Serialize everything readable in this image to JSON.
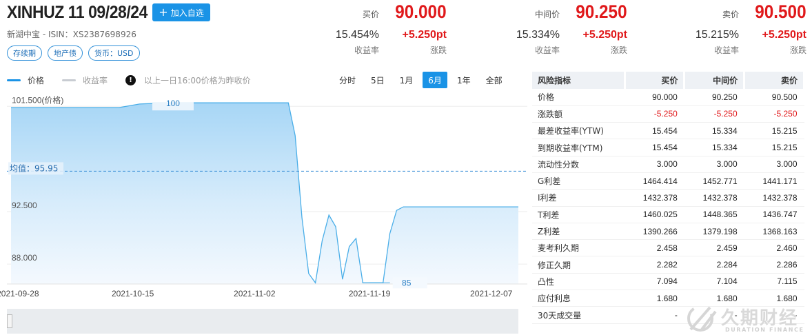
{
  "header": {
    "bond_name": "XINHUZ 11 09/28/24",
    "add_watchlist_label": "加入自选",
    "issuer": "新湖中宝",
    "isin_prefix": " - ISIN：",
    "isin": "XS2387698926",
    "tags": [
      "存续期",
      "地产债",
      "货币：USD"
    ]
  },
  "quotes": [
    {
      "label": "买价",
      "price": "90.000",
      "yield": "15.454%",
      "yield_label": "收益率",
      "change": "+5.250pt",
      "change_label": "涨跌"
    },
    {
      "label": "中间价",
      "price": "90.250",
      "yield": "15.334%",
      "yield_label": "收益率",
      "change": "+5.250pt",
      "change_label": "涨跌"
    },
    {
      "label": "卖价",
      "price": "90.500",
      "yield": "15.215%",
      "yield_label": "收益率",
      "change": "+5.250pt",
      "change_label": "涨跌"
    }
  ],
  "chart_toolbar": {
    "legend_price": "价格",
    "legend_yield": "收益率",
    "note": "以上一日16:00价格为昨收价",
    "ranges": [
      "分时",
      "5日",
      "1月",
      "6月",
      "1年",
      "全部"
    ],
    "active_range": "6月"
  },
  "colors": {
    "accent": "#1a93e6",
    "price_line": "#4aaee8",
    "up_red": "#e0191b",
    "yield_line": "#c8ccd2"
  },
  "chart_data": {
    "type": "area",
    "y_axis_labels": [
      "101.500(价格)",
      "92.500",
      "88.000"
    ],
    "y_tick_values": [
      101.5,
      92.5,
      88.0
    ],
    "ylim": [
      86.3,
      102.4
    ],
    "x_tick_labels": [
      "2021-09-28",
      "2021-10-15",
      "2021-11-02",
      "2021-11-19",
      "2021-12-07"
    ],
    "x_tick_dates": [
      "2021-09-28",
      "2021-10-15",
      "2021-11-02",
      "2021-11-19",
      "2021-12-07"
    ],
    "xlim": [
      "2021-09-27",
      "2021-12-11"
    ],
    "average_label": "均值：95.95",
    "average_value": 95.95,
    "max_label": "100",
    "min_label": "85",
    "series": [
      {
        "name": "价格",
        "points": [
          [
            "2021-09-27",
            101.4
          ],
          [
            "2021-10-10",
            101.4
          ],
          [
            "2021-10-13",
            101.4
          ],
          [
            "2021-10-16",
            101.7
          ],
          [
            "2021-10-20",
            101.8
          ],
          [
            "2021-11-01",
            101.8
          ],
          [
            "2021-11-07",
            101.8
          ],
          [
            "2021-11-08",
            99.0
          ],
          [
            "2021-11-09",
            92.0
          ],
          [
            "2021-11-10",
            87.2
          ],
          [
            "2021-11-11",
            86.4
          ],
          [
            "2021-11-12",
            90.0
          ],
          [
            "2021-11-13",
            92.2
          ],
          [
            "2021-11-14",
            91.2
          ],
          [
            "2021-11-15",
            86.7
          ],
          [
            "2021-11-16",
            89.5
          ],
          [
            "2021-11-17",
            90.2
          ],
          [
            "2021-11-18",
            86.4
          ],
          [
            "2021-11-20",
            86.4
          ],
          [
            "2021-11-21",
            86.4
          ],
          [
            "2021-11-22",
            90.6
          ],
          [
            "2021-11-23",
            92.6
          ],
          [
            "2021-11-24",
            92.9
          ],
          [
            "2021-12-11",
            92.9
          ]
        ]
      }
    ]
  },
  "risk_table": {
    "headers": [
      "风险指标",
      "买价",
      "中间价",
      "卖价"
    ],
    "rows": [
      [
        "价格",
        "90.000",
        "90.250",
        "90.500"
      ],
      [
        "涨跌额",
        "-5.250",
        "-5.250",
        "-5.250"
      ],
      [
        "最差收益率(YTW)",
        "15.454",
        "15.334",
        "15.215"
      ],
      [
        "到期收益率(YTM)",
        "15.454",
        "15.334",
        "15.215"
      ],
      [
        "流动性分数",
        "3.000",
        "3.000",
        "3.000"
      ],
      [
        "G利差",
        "1464.414",
        "1452.771",
        "1441.171"
      ],
      [
        "I利差",
        "1432.378",
        "1432.378",
        "1432.378"
      ],
      [
        "T利差",
        "1460.025",
        "1448.365",
        "1436.747"
      ],
      [
        "Z利差",
        "1390.266",
        "1379.198",
        "1368.163"
      ],
      [
        "麦考利久期",
        "2.458",
        "2.459",
        "2.460"
      ],
      [
        "修正久期",
        "2.282",
        "2.284",
        "2.286"
      ],
      [
        "凸性",
        "7.094",
        "7.104",
        "7.115"
      ],
      [
        "应付利息",
        "1.680",
        "1.680",
        "1.680"
      ],
      [
        "30天成交量",
        "-",
        "-",
        "-"
      ]
    ],
    "negative_row": "涨跌额"
  },
  "watermark": {
    "brand_cn": "久期财经",
    "brand_en": "DURATION FINANCE"
  }
}
